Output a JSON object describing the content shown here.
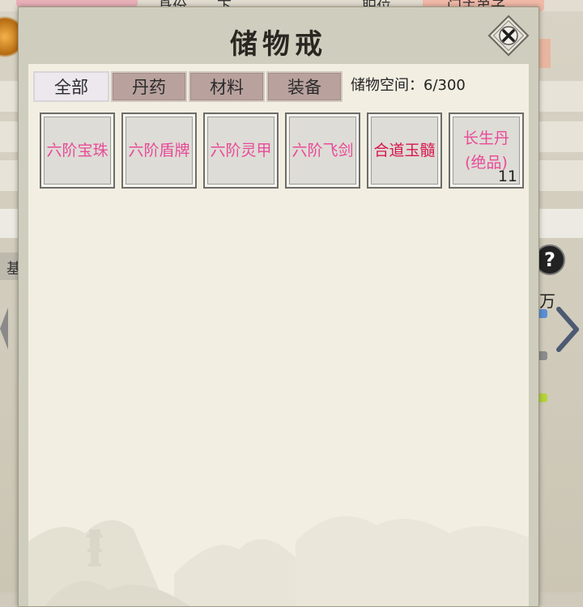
{
  "background": {
    "left_tag": "基",
    "right_unit": "万",
    "help_glyph": "?",
    "top_texts": [
      "身份",
      "下",
      "职位",
      "门主弟子"
    ]
  },
  "dialog": {
    "title": "储物戒",
    "close_glyph": "✕"
  },
  "tabs": [
    {
      "label": "全部",
      "active": true
    },
    {
      "label": "丹药",
      "active": false
    },
    {
      "label": "材料",
      "active": false
    },
    {
      "label": "装备",
      "active": false
    }
  ],
  "storage": {
    "label": "储物空间：6/300"
  },
  "items": [
    {
      "name": "六阶宝珠",
      "color": "#e84a98",
      "count": ""
    },
    {
      "name": "六阶盾牌",
      "color": "#e84a98",
      "count": ""
    },
    {
      "name": "六阶灵甲",
      "color": "#e84a98",
      "count": ""
    },
    {
      "name": "六阶飞剑",
      "color": "#e84a98",
      "count": ""
    },
    {
      "name": "合道玉髓",
      "color": "#d8154f",
      "count": ""
    },
    {
      "name": "长生丹\n(绝品)",
      "color": "#e84a98",
      "count": "11"
    }
  ],
  "colors": {
    "item_pink": "#e84a98",
    "item_red": "#d8154f",
    "tab_inactive": "#b9a29e",
    "panel": "#f2efe2"
  }
}
